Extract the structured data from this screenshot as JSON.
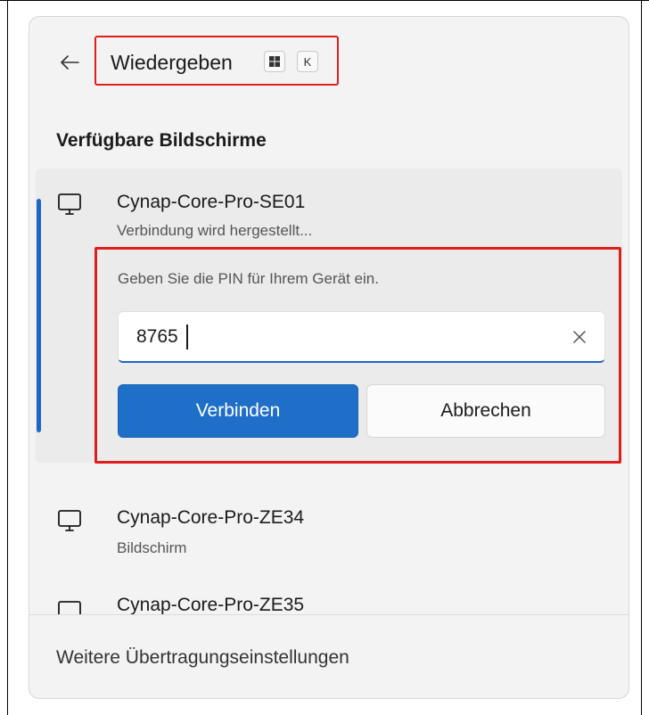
{
  "header": {
    "title": "Wiedergeben",
    "shortcut_keys": [
      {
        "type": "windows-logo-icon",
        "label": ""
      },
      {
        "type": "text",
        "label": "K"
      }
    ]
  },
  "section_heading": "Verfügbare Bildschirme",
  "selected_device": {
    "name": "Cynap-Core-Pro-SE01",
    "status": "Verbindung wird hergestellt...",
    "icon": "monitor-icon"
  },
  "pin_prompt": {
    "label": "Geben Sie die PIN für Ihrem Gerät ein.",
    "value": "8765",
    "connect_label": "Verbinden",
    "cancel_label": "Abbrechen"
  },
  "devices": [
    {
      "name": "Cynap-Core-Pro-ZE34",
      "status": "Bildschirm",
      "icon": "monitor-icon"
    },
    {
      "name": "Cynap-Core-Pro-ZE35",
      "status": "",
      "icon": "monitor-icon"
    }
  ],
  "footer": {
    "more_settings": "Weitere Übertragungseinstellungen"
  },
  "colors": {
    "accent": "#1f6fc9",
    "highlight": "#e01e1e",
    "panel_bg": "#f3f3f3"
  }
}
